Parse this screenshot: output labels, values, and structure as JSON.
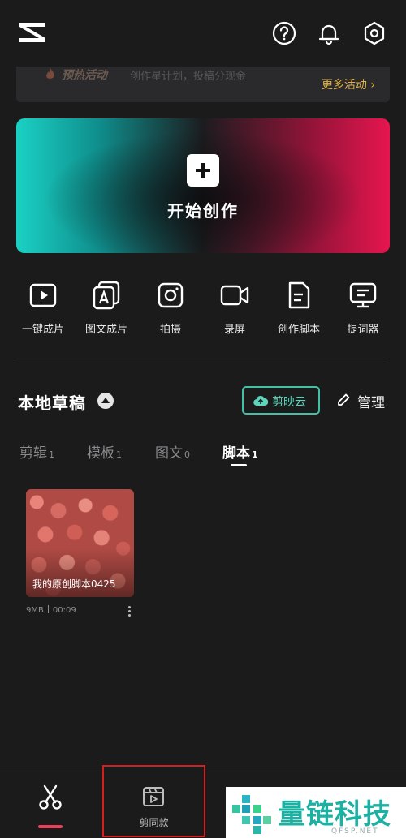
{
  "banner": {
    "title": "预热活动",
    "subtitle": "创作星计划，投稿分现金",
    "more": "更多活动 ›"
  },
  "hero": {
    "label": "开始创作"
  },
  "tools": [
    {
      "label": "一键成片",
      "icon": "play-icon"
    },
    {
      "label": "图文成片",
      "icon": "text-image-icon"
    },
    {
      "label": "拍摄",
      "icon": "camera-icon"
    },
    {
      "label": "录屏",
      "icon": "record-icon"
    },
    {
      "label": "创作脚本",
      "icon": "script-icon"
    },
    {
      "label": "提词器",
      "icon": "teleprompter-icon"
    }
  ],
  "drafts": {
    "title": "本地草稿",
    "cloud": "剪映云",
    "manage": "管理"
  },
  "tabs": [
    {
      "label": "剪辑",
      "count": "1"
    },
    {
      "label": "模板",
      "count": "1"
    },
    {
      "label": "图文",
      "count": "0"
    },
    {
      "label": "脚本",
      "count": "1",
      "active": true
    }
  ],
  "card": {
    "title": "我的原创脚本0425",
    "size": "9MB",
    "duration": "00:09"
  },
  "bottom_nav": {
    "template_label": "剪同款"
  },
  "watermark": {
    "text": "量链科技",
    "sub": "QFSP.NET"
  },
  "colors": {
    "accent_teal": "#42c0a8",
    "accent_red": "#e8405a",
    "highlight_box": "#d51f1f",
    "more_gold": "#e3b24a"
  }
}
